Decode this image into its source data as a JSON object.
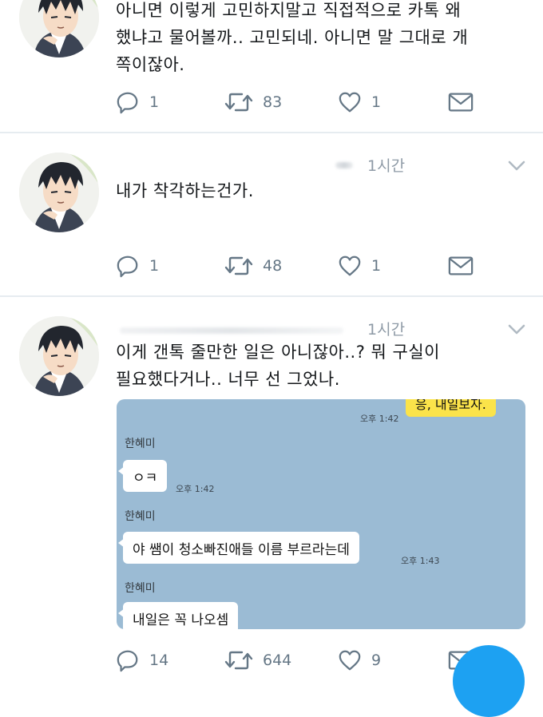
{
  "colors": {
    "accent": "#1da1f2",
    "muted": "#8e9aa6",
    "chat_bg": "#9bbbd4",
    "my_bubble": "#fbe34a"
  },
  "tweets": [
    {
      "text": "아니면 이렇게 고민하지말고 직접적으로 카톡 왜\n했냐고 물어볼까.. 고민되네. 아니면 말 그대로 개\n쪽이잖아.",
      "time": "",
      "replies": "1",
      "retweets": "83",
      "likes": "1"
    },
    {
      "text": "내가 착각하는건가.",
      "time": "1시간",
      "replies": "1",
      "retweets": "48",
      "likes": "1"
    },
    {
      "text": "이게 갠톡 줄만한 일은 아니잖아..? 뭐 구실이\n필요했다거나.. 너무 선 그었나.",
      "time": "1시간",
      "replies": "14",
      "retweets": "644",
      "likes": "9"
    }
  ],
  "chat": {
    "my_message": "응, 내일보자.",
    "my_time": "오후 1:42",
    "messages": [
      {
        "sender": "한혜미",
        "text": "ㅇㅋ",
        "time": "오후 1:42"
      },
      {
        "sender": "한혜미",
        "text": "야 쌤이 청소빠진애들 이름 부르라는데",
        "time": "오후 1:43"
      },
      {
        "sender": "한혜미",
        "text": "내일은 꼭 나오셈",
        "time": ""
      }
    ]
  }
}
